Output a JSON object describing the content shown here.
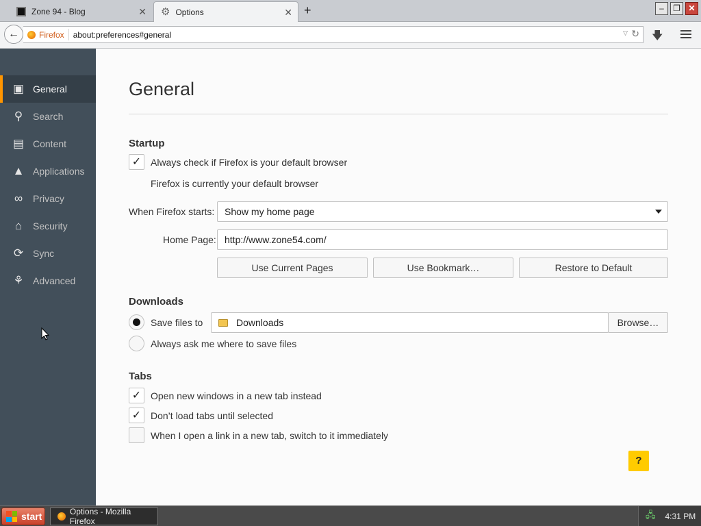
{
  "browser": {
    "tabs": [
      {
        "title": "Zone 94 - Blog",
        "active": false
      },
      {
        "title": "Options",
        "active": true
      }
    ],
    "url": {
      "identity_label": "Firefox",
      "address": "about:preferences#general"
    }
  },
  "sidebar": {
    "items": [
      {
        "label": "General",
        "icon": "general-icon",
        "selected": true
      },
      {
        "label": "Search",
        "icon": "search-icon"
      },
      {
        "label": "Content",
        "icon": "content-icon"
      },
      {
        "label": "Applications",
        "icon": "applications-icon"
      },
      {
        "label": "Privacy",
        "icon": "privacy-mask-icon"
      },
      {
        "label": "Security",
        "icon": "security-lock-icon"
      },
      {
        "label": "Sync",
        "icon": "sync-icon"
      },
      {
        "label": "Advanced",
        "icon": "advanced-wizard-icon"
      }
    ]
  },
  "main": {
    "title": "General",
    "startup": {
      "heading": "Startup",
      "default_check_label": "Always check if Firefox is your default browser",
      "default_check_checked": true,
      "default_status": "Firefox is currently your default browser",
      "when_starts_label": "When Firefox starts:",
      "when_starts_value": "Show my home page",
      "home_page_label": "Home Page:",
      "home_page_value": "http://www.zone54.com/",
      "use_current_pages": "Use Current Pages",
      "use_bookmark": "Use Bookmark…",
      "restore_default": "Restore to Default"
    },
    "downloads": {
      "heading": "Downloads",
      "save_files_label": "Save files to",
      "save_files_selected": true,
      "folder": "Downloads",
      "browse": "Browse…",
      "ask_label": "Always ask me where to save files"
    },
    "tabs": {
      "heading": "Tabs",
      "options": [
        {
          "label": "Open new windows in a new tab instead",
          "checked": true
        },
        {
          "label": "Don’t load tabs until selected",
          "checked": true
        },
        {
          "label": "When I open a link in a new tab, switch to it immediately",
          "checked": false
        }
      ]
    },
    "help": "?"
  },
  "taskbar": {
    "start": "start",
    "task_title": "Options - Mozilla Firefox",
    "clock": "4:31 PM"
  },
  "colors": {
    "sidebar_bg": "#424f5a",
    "sidebar_selected_accent": "#ff9500",
    "help_button": "#ffcb00"
  }
}
